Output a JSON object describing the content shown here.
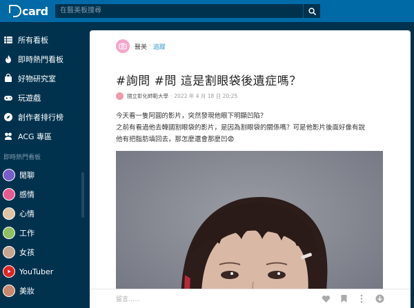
{
  "header": {
    "logo_text": "card",
    "search_placeholder": "在醫美板搜尋"
  },
  "sidebar": {
    "nav": [
      {
        "label": "所有看板",
        "icon": "list-icon"
      },
      {
        "label": "即時熱門看板",
        "icon": "flame-icon"
      },
      {
        "label": "好物研究室",
        "icon": "shopping-icon"
      },
      {
        "label": "玩遊戲",
        "icon": "gamepad-icon"
      },
      {
        "label": "創作者排行榜",
        "icon": "compass-icon"
      },
      {
        "label": "ACG 專區",
        "icon": "paw-icon"
      }
    ],
    "section_label": "即時熱門看板",
    "boards": [
      {
        "label": "閒聊",
        "color": "#7a5cc7"
      },
      {
        "label": "感情",
        "color": "#e85a8f"
      },
      {
        "label": "心情",
        "color": "#e0c3a2"
      },
      {
        "label": "工作",
        "color": "#8fbf5e"
      },
      {
        "label": "女孩",
        "color": "#c9a58c"
      },
      {
        "label": "YouTuber",
        "color": "#e02424"
      },
      {
        "label": "美妝",
        "color": "#c9876b"
      }
    ]
  },
  "post": {
    "forum": "醫美",
    "follow": "追蹤",
    "title": "#詢問 #問 這是割眼袋後遺症嗎？",
    "school": "國立彰化師範大學",
    "date": "2022 年 4 月 18 日 20:25",
    "body_lines": [
      "今天看一隻阿圓的影片，突然發現他眼下明顯凹陷？",
      "之前有看過他去韓國割眼袋的影片，是因為割眼袋的關係嗎？可是他影片後面好像有說",
      "他有把脂肪填回去，那怎麼還會那麼凹😨"
    ]
  },
  "actions": {
    "comment_placeholder": "留言......"
  },
  "colors": {
    "header": "#006aa6",
    "sidebar": "#00324e",
    "follow": "#3397cf"
  }
}
